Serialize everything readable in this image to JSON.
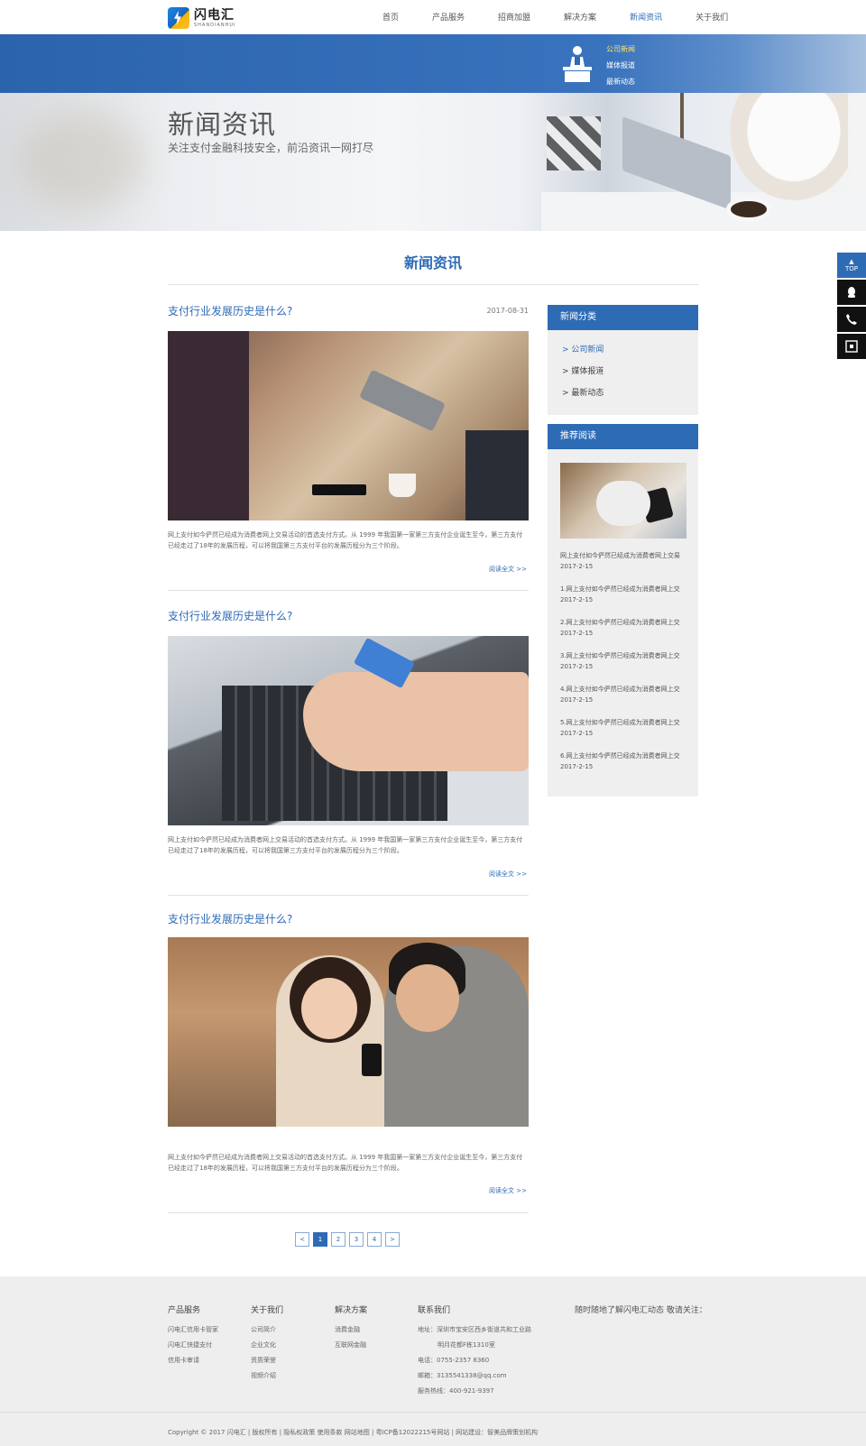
{
  "brand": {
    "name": "闪电汇",
    "sub": "SHANDIANHUI"
  },
  "nav": [
    "首页",
    "产品服务",
    "招商加盟",
    "解决方案",
    "新闻资讯",
    "关于我们"
  ],
  "nav_active": 4,
  "subnav": [
    "公司新闻",
    "媒体报道",
    "最新动态"
  ],
  "hero": {
    "title": "新闻资讯",
    "subtitle": "关注支付金融科技安全，前沿资讯一网打尽"
  },
  "float_bar": {
    "top": "TOP"
  },
  "section_title": "新闻资讯",
  "articles": [
    {
      "title": "支付行业发展历史是什么?",
      "date": "2017-08-31",
      "text": "网上支付如今俨然已经成为消费者网上交易活动的首选支付方式。从 1999 年我国第一家第三方支付企业诞生至今，第三方支付已经走过了18年的发展历程，可以将我国第三方支付平台的发展历程分为三个阶段。",
      "more": "阅读全文 >>"
    },
    {
      "title": "支付行业发展历史是什么?",
      "date": "",
      "text": "网上支付如今俨然已经成为消费者网上交易活动的首选支付方式。从 1999 年我国第一家第三方支付企业诞生至今，第三方支付已经走过了18年的发展历程，可以将我国第三方支付平台的发展历程分为三个阶段。",
      "more": "阅读全文 >>"
    },
    {
      "title": "支付行业发展历史是什么?",
      "date": "",
      "text": "网上支付如今俨然已经成为消费者网上交易活动的首选支付方式。从 1999 年我国第一家第三方支付企业诞生至今，第三方支付已经走过了18年的发展历程，可以将我国第三方支付平台的发展历程分为三个阶段。",
      "more": "阅读全文 >>"
    }
  ],
  "pager": [
    "<",
    "1",
    "2",
    "3",
    "4",
    ">"
  ],
  "pager_active": 1,
  "sidebar": {
    "categories_title": "新闻分类",
    "categories": [
      "> 公司新闻",
      "> 媒体报道",
      "> 最新动态"
    ],
    "recommend_title": "推荐阅读",
    "recommend": [
      {
        "title": "网上支付如今俨然已经成为消费者网上交易",
        "date": "2017-2-15"
      },
      {
        "title": "1.网上支付如今俨然已经成为消费者网上交",
        "date": "2017-2-15"
      },
      {
        "title": "2.网上支付如今俨然已经成为消费者网上交",
        "date": "2017-2-15"
      },
      {
        "title": "3.网上支付如今俨然已经成为消费者网上交",
        "date": "2017-2-15"
      },
      {
        "title": "4.网上支付如今俨然已经成为消费者网上交",
        "date": "2017-2-15"
      },
      {
        "title": "5.网上支付如今俨然已经成为消费者网上交",
        "date": "2017-2-15"
      },
      {
        "title": "6.网上支付如今俨然已经成为消费者网上交",
        "date": "2017-2-15"
      }
    ]
  },
  "footer": {
    "products": {
      "title": "产品服务",
      "items": [
        "闪电汇信用卡管家",
        "闪电汇快捷支付",
        "信用卡审请"
      ]
    },
    "about": {
      "title": "关于我们",
      "items": [
        "公司简介",
        "企业文化",
        "资质荣誉",
        "视频介绍"
      ]
    },
    "solutions": {
      "title": "解决方案",
      "items": [
        "消费金融",
        "互联网金融"
      ]
    },
    "contact": {
      "title": "联系我们",
      "items": [
        "地址：深圳市宝安区西乡街道共和工业路",
        "明月花都F栋1310室",
        "电话：0755-2357 8360",
        "邮箱：3135541338@qq.com",
        "服务热线：400-921-9397"
      ]
    },
    "follow": "随时随地了解闪电汇动态 敬请关注：",
    "copyright": "Copyright © 2017 闪电汇   |   版权所有   |   隐私权政策   使用条款   网站地图   |   粤ICP备12022215号网站   |   网站建设：智美品牌策划机构"
  }
}
